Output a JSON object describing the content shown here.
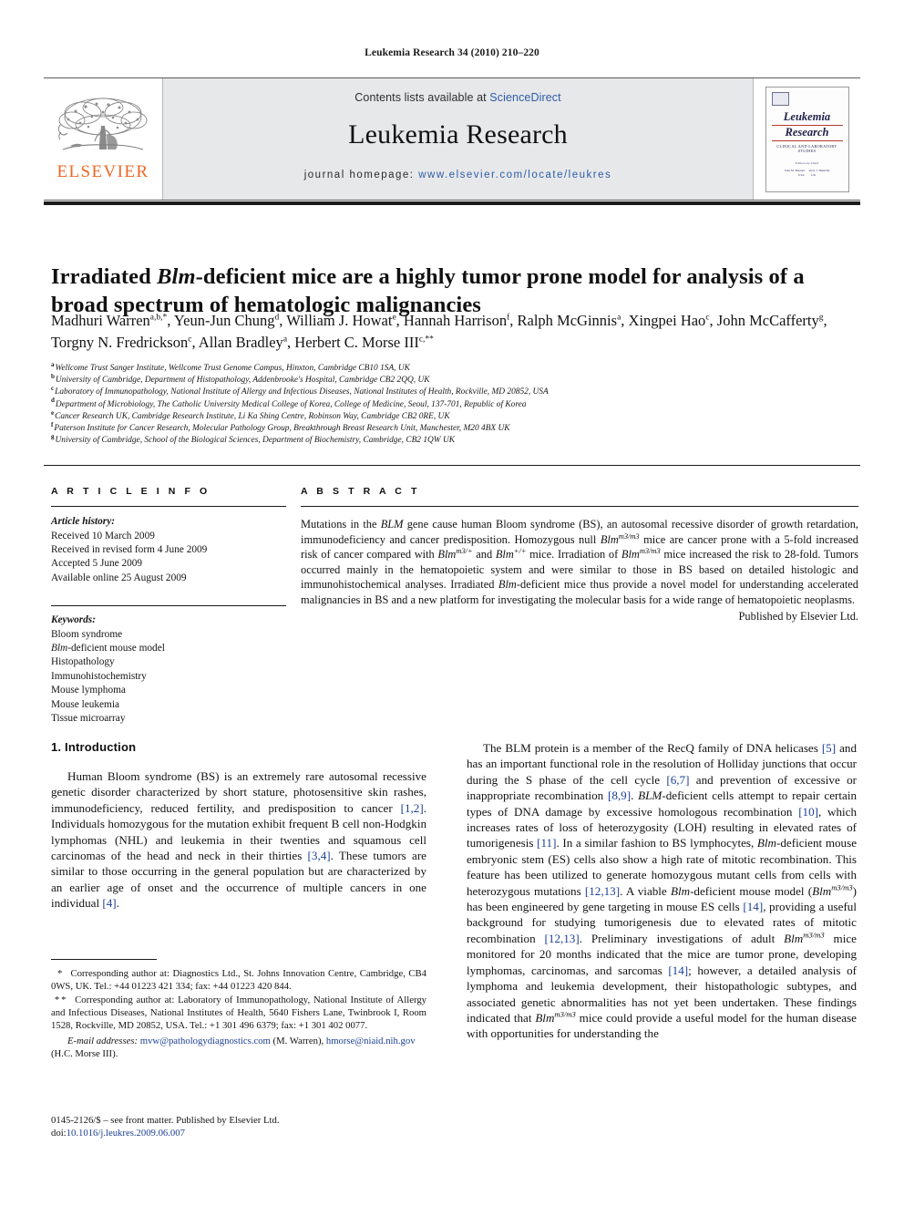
{
  "running_head": "Leukemia Research 34 (2010) 210–220",
  "masthead": {
    "publisher_logo_text": "ELSEVIER",
    "contents_prefix": "Contents lists available at",
    "contents_link": "ScienceDirect",
    "journal_name": "Leukemia Research",
    "homepage_prefix": "journal homepage:",
    "homepage_url": "www.elsevier.com/locate/leukres",
    "cover": {
      "title_line1": "Leukemia",
      "title_line2": "Research",
      "subtitle": "CLINICAL AND LABORATORY STUDIES",
      "editors_header": "Editors-in-Chief",
      "editor_1_name": "John M. Bennett",
      "editor_1_loc": "USA",
      "editor_2_name": "Terry J. Hamblin",
      "editor_2_loc": "UK"
    },
    "cover_accent_color": "#b83a2b",
    "link_color": "#2d5ca8",
    "elsevier_orange": "#ec6726"
  },
  "article": {
    "title_part1": "Irradiated ",
    "title_italic": "Blm",
    "title_part2": "-deficient mice are a highly tumor prone model for analysis of a broad spectrum of hematologic malignancies",
    "authors": [
      {
        "name": "Madhuri Warren",
        "sup": "a,b,*",
        "sep": ", "
      },
      {
        "name": "Yeun-Jun Chung",
        "sup": "d",
        "sep": ", "
      },
      {
        "name": "William J. Howat",
        "sup": "e",
        "sep": ", "
      },
      {
        "name": "Hannah Harrison",
        "sup": "f",
        "sep": ", "
      },
      {
        "name": "Ralph McGinnis",
        "sup": "a",
        "sep": ", "
      },
      {
        "name": "Xingpei Hao",
        "sup": "c",
        "sep": ", "
      },
      {
        "name": "John McCafferty",
        "sup": "g",
        "sep": ", "
      },
      {
        "name": "Torgny N. Fredrickson",
        "sup": "c",
        "sep": ", "
      },
      {
        "name": "Allan Bradley",
        "sup": "a",
        "sep": ", "
      },
      {
        "name": "Herbert C. Morse III",
        "sup": "c,**",
        "sep": ""
      }
    ],
    "affiliations": [
      {
        "mark": "a",
        "text": "Wellcome Trust Sanger Institute, Wellcome Trust Genome Campus, Hinxton, Cambridge CB10 1SA, UK"
      },
      {
        "mark": "b",
        "text": "University of Cambridge, Department of Histopathology, Addenbrooke's Hospital, Cambridge CB2 2QQ, UK"
      },
      {
        "mark": "c",
        "text": "Laboratory of Immunopathology, National Institute of Allergy and Infectious Diseases, National Institutes of Health, Rockville, MD 20852, USA"
      },
      {
        "mark": "d",
        "text": "Department of Microbiology, The Catholic University Medical College of Korea, College of Medicine, Seoul, 137-701, Republic of Korea"
      },
      {
        "mark": "e",
        "text": "Cancer Research UK, Cambridge Research Institute, Li Ka Shing Centre, Robinson Way, Cambridge CB2 0RE, UK"
      },
      {
        "mark": "f",
        "text": "Paterson Institute for Cancer Research, Molecular Pathology Group, Breakthrough Breast Research Unit, Manchester, M20 4BX UK"
      },
      {
        "mark": "g",
        "text": "University of Cambridge, School of the Biological Sciences, Department of Biochemistry, Cambridge, CB2 1QW UK"
      }
    ]
  },
  "article_info": {
    "heading": "A R T I C L E   I N F O",
    "history_label": "Article history:",
    "history": [
      "Received 10 March 2009",
      "Received in revised form 4 June 2009",
      "Accepted 5 June 2009",
      "Available online 25 August 2009"
    ],
    "keywords_label": "Keywords:",
    "keywords": [
      "Bloom syndrome",
      "Blm-deficient mouse model",
      "Histopathology",
      "Immunohistochemistry",
      "Mouse lymphoma",
      "Mouse leukemia",
      "Tissue microarray"
    ]
  },
  "abstract": {
    "heading": "A B S T R A C T",
    "publisher_line": "Published by Elsevier Ltd."
  },
  "introduction": {
    "heading": "1.  Introduction"
  },
  "footnotes": {
    "corresponding_1_mark": "*",
    "corresponding_1": "Corresponding author at: Diagnostics Ltd., St. Johns Innovation Centre, Cambridge, CB4 0WS, UK. Tel.: +44 01223 421 334; fax: +44 01223 420 844.",
    "corresponding_2_mark": "**",
    "corresponding_2": "Corresponding author at: Laboratory of Immunopathology, National Institute of Allergy and Infectious Diseases, National Institutes of Health, 5640 Fishers Lane, Twinbrook I, Room 1528, Rockville, MD 20852, USA. Tel.: +1 301 496 6379; fax: +1 301 402 0077.",
    "email_label": "E-mail addresses:",
    "email_1": "mvw@pathologydiagnostics.com",
    "email_1_owner": "(M. Warren),",
    "email_2": "hmorse@niaid.nih.gov",
    "email_2_owner": "(H.C. Morse III)."
  },
  "colophon": {
    "front_matter": "0145-2126/$ – see front matter. Published by Elsevier Ltd.",
    "doi_label": "doi:",
    "doi": "10.1016/j.leukres.2009.06.007"
  }
}
